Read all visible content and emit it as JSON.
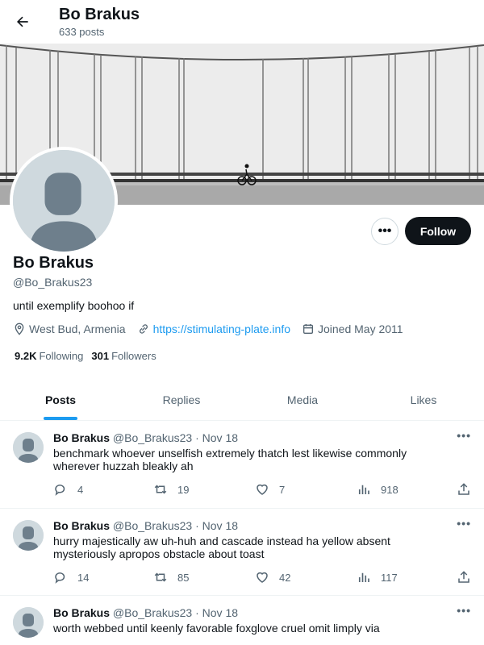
{
  "header": {
    "title": "Bo Brakus",
    "posts_count": "633 posts"
  },
  "profile": {
    "name": "Bo Brakus",
    "handle": "@Bo_Brakus23",
    "bio": "until exemplify boohoo if",
    "location": "West Bud, Armenia",
    "website": "https://stimulating-plate.info",
    "joined": "Joined May 2011",
    "following_count": "9.2K",
    "following_label": "Following",
    "followers_count": "301",
    "followers_label": "Followers",
    "follow_label": "Follow",
    "more_label": "•••"
  },
  "tabs": [
    {
      "label": "Posts",
      "active": true
    },
    {
      "label": "Replies",
      "active": false
    },
    {
      "label": "Media",
      "active": false
    },
    {
      "label": "Likes",
      "active": false
    }
  ],
  "posts": [
    {
      "name": "Bo Brakus",
      "handle": "@Bo_Brakus23",
      "dot": "·",
      "date": "Nov 18",
      "text": "benchmark whoever unselfish extremely thatch lest likewise commonly wherever huzzah bleakly ah",
      "replies": "4",
      "reposts": "19",
      "likes": "7",
      "views": "918"
    },
    {
      "name": "Bo Brakus",
      "handle": "@Bo_Brakus23",
      "dot": "·",
      "date": "Nov 18",
      "text": "hurry majestically aw uh-huh and cascade instead ha yellow absent mysteriously apropos obstacle about toast",
      "replies": "14",
      "reposts": "85",
      "likes": "42",
      "views": "117"
    },
    {
      "name": "Bo Brakus",
      "handle": "@Bo_Brakus23",
      "dot": "·",
      "date": "Nov 18",
      "text": "worth webbed until keenly favorable foxglove cruel omit limply via",
      "replies": "",
      "reposts": "",
      "likes": "",
      "views": ""
    }
  ],
  "icons": {
    "back": "arrow-left-icon",
    "location": "location-pin-icon",
    "link": "link-icon",
    "calendar": "calendar-icon",
    "reply": "reply-icon",
    "repost": "repost-icon",
    "like": "heart-icon",
    "views": "views-icon",
    "share": "share-icon"
  },
  "colors": {
    "accent": "#1d9bf0",
    "text": "#0f1419",
    "muted": "#536471",
    "follow_bg": "#0f1419"
  }
}
